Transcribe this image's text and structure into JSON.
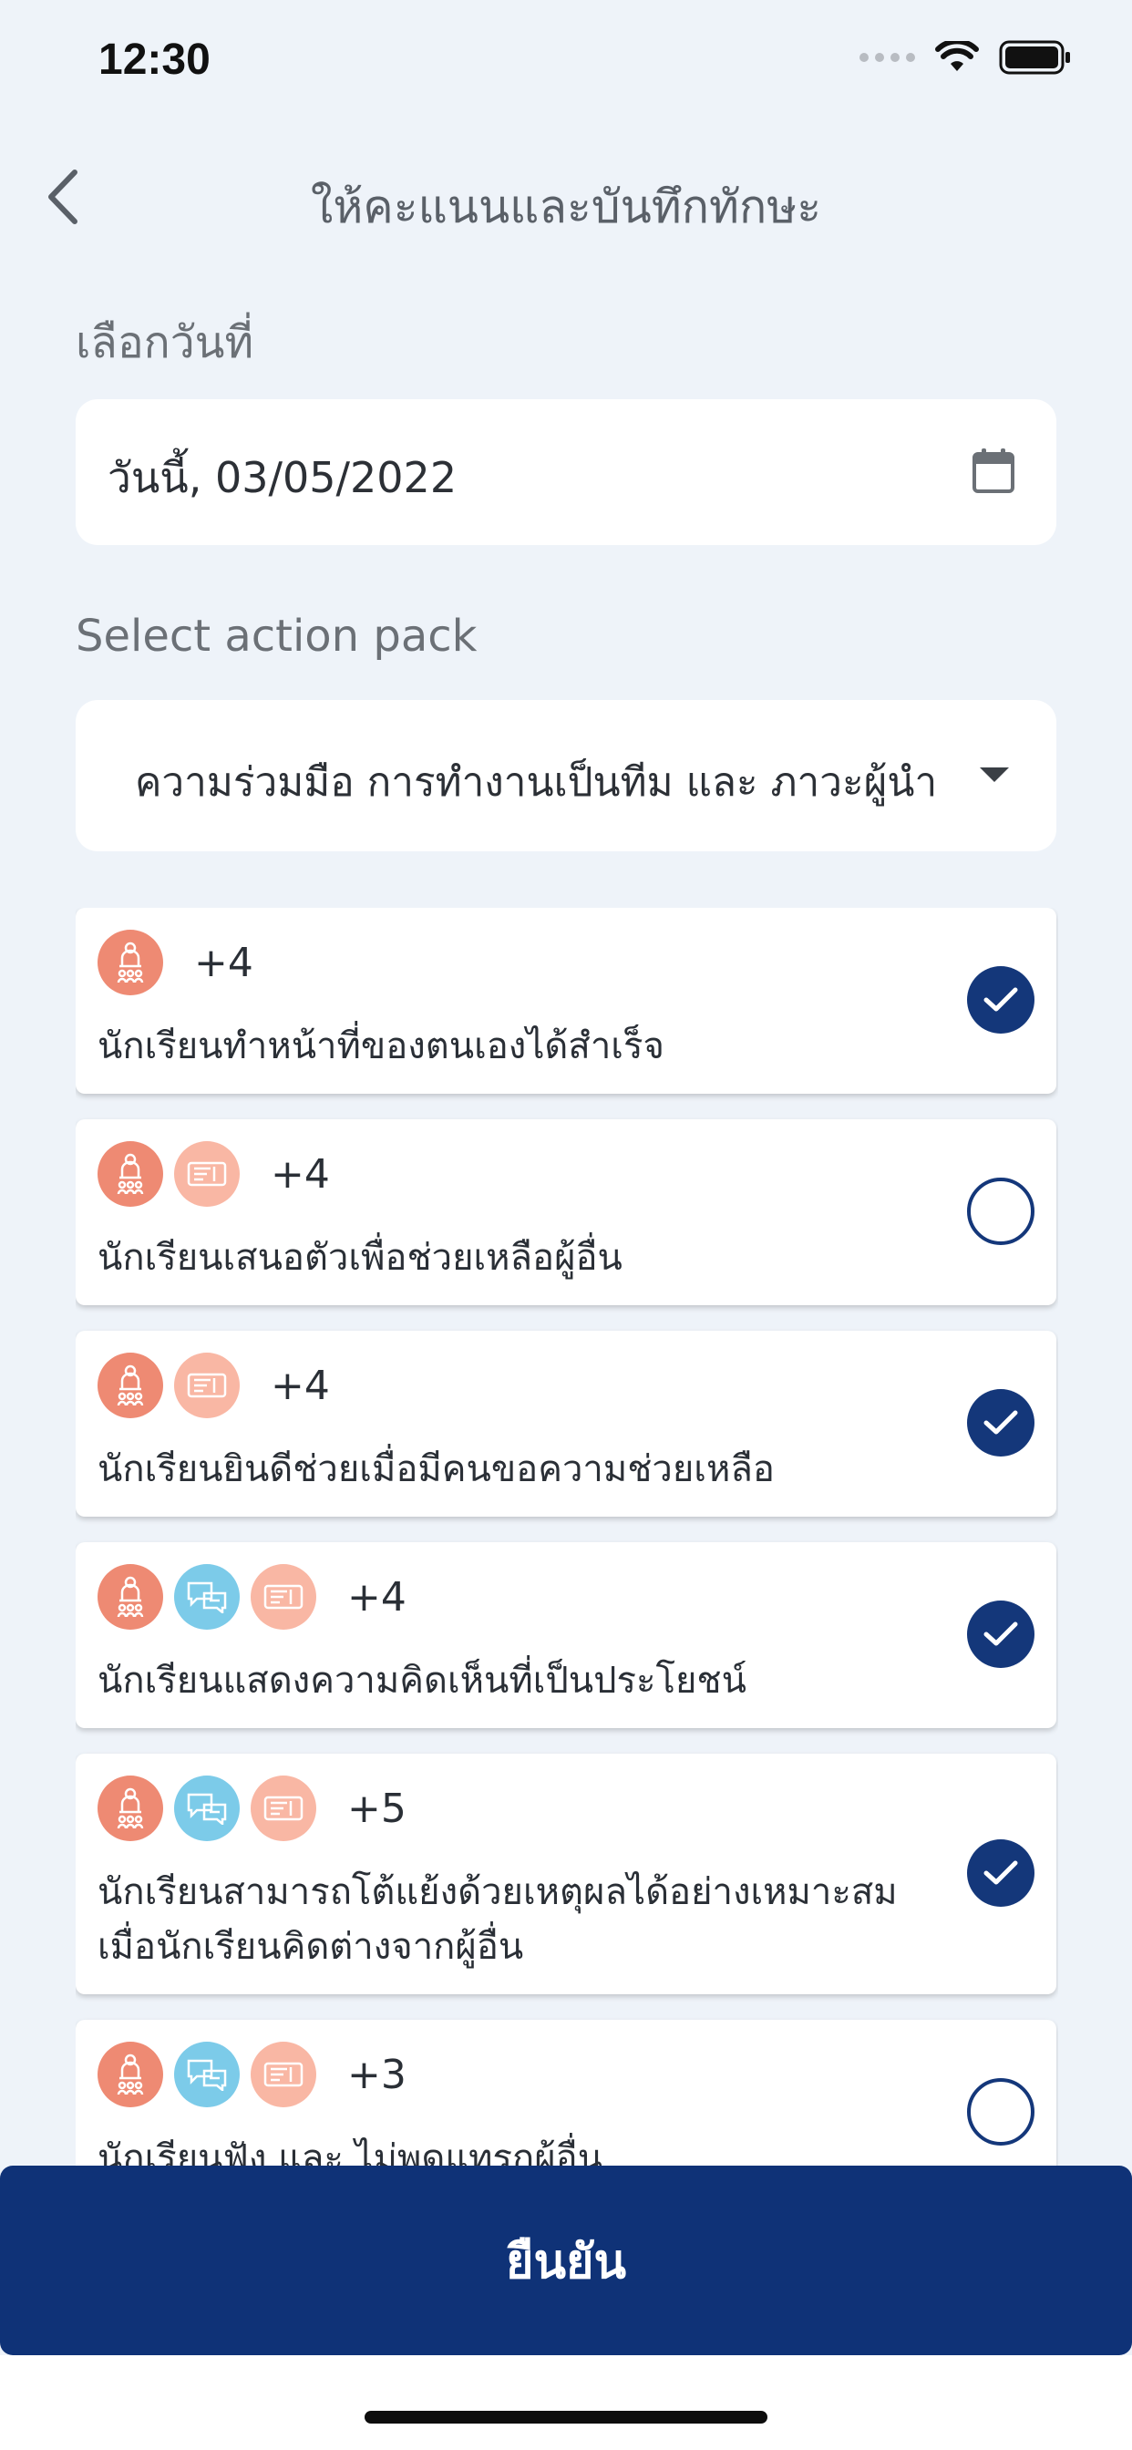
{
  "status_bar": {
    "time": "12:30"
  },
  "nav": {
    "title": "ให้คะแนนและบันทึกทักษะ"
  },
  "date_section": {
    "label": "เลือกวันที่",
    "value": "วันนี้, 03/05/2022"
  },
  "pack_section": {
    "label": "Select action pack",
    "value": "ความร่วมมือ การทำงานเป็นทีม และ ภาวะผู้นำ"
  },
  "colors": {
    "primary": "#0f3277",
    "salmon": "#ee8a73",
    "peach": "#f9b7a4",
    "blue": "#7ccbe9",
    "background": "#eef3f9"
  },
  "actions": [
    {
      "points": "+4",
      "text": "นักเรียนทำหน้าที่ของตนเองได้สำเร็จ",
      "checked": true,
      "icons": [
        "leader-icon"
      ]
    },
    {
      "points": "+4",
      "text": "นักเรียนเสนอตัวเพื่อช่วยเหลือผู้อื่น",
      "checked": false,
      "icons": [
        "leader-icon",
        "ticket-icon"
      ]
    },
    {
      "points": "+4",
      "text": "นักเรียนยินดีช่วยเมื่อมีคนขอความช่วยเหลือ",
      "checked": true,
      "icons": [
        "leader-icon",
        "ticket-icon"
      ]
    },
    {
      "points": "+4",
      "text": "นักเรียนแสดงความคิดเห็นที่เป็นประโยชน์",
      "checked": true,
      "icons": [
        "leader-icon",
        "chat-icon",
        "ticket-icon"
      ]
    },
    {
      "points": "+5",
      "text": "นักเรียนสามารถโต้แย้งด้วยเหตุผลได้อย่างเหมาะสม เมื่อนักเรียนคิดต่างจากผู้อื่น",
      "checked": true,
      "icons": [
        "leader-icon",
        "chat-icon",
        "ticket-icon"
      ]
    },
    {
      "points": "+3",
      "text": "นักเรียนฟัง และ ไม่พูดแทรกผู้อื่น",
      "checked": false,
      "icons": [
        "leader-icon",
        "chat-icon",
        "ticket-icon"
      ]
    }
  ],
  "confirm": {
    "label": "ยืนยัน"
  }
}
